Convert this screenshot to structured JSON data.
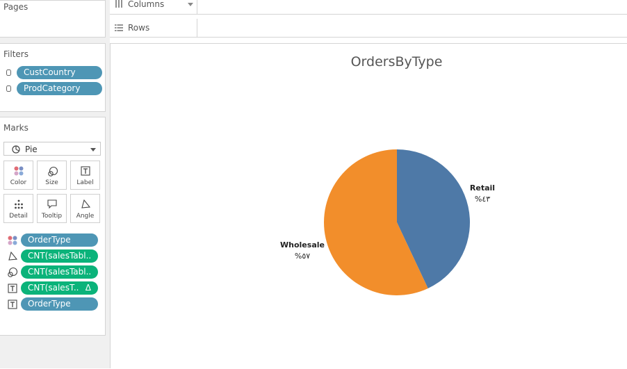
{
  "pages": {
    "title": "Pages"
  },
  "filters": {
    "title": "Filters",
    "items": [
      "CustCountry",
      "ProdCategory"
    ]
  },
  "marks": {
    "title": "Marks",
    "mark_type": "Pie",
    "buttons": [
      "Color",
      "Size",
      "Label",
      "Detail",
      "Tooltip",
      "Angle"
    ],
    "fields": [
      "OrderType",
      "CNT(salesTabl..",
      "CNT(salesTabl..",
      "CNT(salesT..",
      "OrderType"
    ],
    "delta_glyph": "Δ"
  },
  "shelves": {
    "columns": "Columns",
    "rows": "Rows"
  },
  "colors": {
    "retail": "#4e79a7",
    "wholesale": "#f28e2b",
    "pill_blue": "#4e96b5",
    "pill_green": "#0bb37a"
  },
  "chart_data": {
    "type": "pie",
    "title": "OrdersByType",
    "categories": [
      "Retail",
      "Wholesale"
    ],
    "values": [
      43,
      57
    ],
    "labels": [
      "%٤٣",
      "%٥٧"
    ]
  }
}
